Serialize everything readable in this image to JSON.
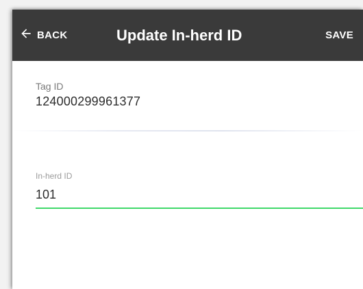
{
  "appbar": {
    "back_label": "BACK",
    "back_icon": "arrow-left-icon",
    "title": "Update In-herd ID",
    "save_label": "SAVE",
    "background": "#3a3a3a"
  },
  "tag": {
    "label": "Tag ID",
    "value": "124000299961377"
  },
  "inherd": {
    "label": "In-herd ID",
    "value": "101",
    "accent": "#3fd86a"
  }
}
